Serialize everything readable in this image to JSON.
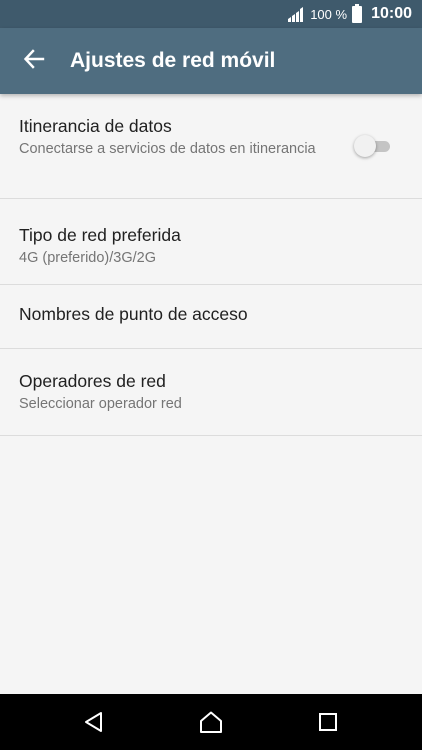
{
  "status_bar": {
    "battery_percent": "100 %",
    "time": "10:00",
    "icons": [
      "signal-icon",
      "battery-icon"
    ]
  },
  "app_bar": {
    "title": "Ajustes de red móvil",
    "back_icon": "arrow-left-icon"
  },
  "settings": {
    "items": [
      {
        "title": "Itinerancia de datos",
        "summary": "Conectarse a servicios de datos en itinerancia",
        "toggle": {
          "type": "switch",
          "on": false
        }
      },
      {
        "title": "Tipo de red preferida",
        "summary": "4G (preferido)/3G/2G"
      },
      {
        "title": "Nombres de punto de acceso"
      },
      {
        "title": "Operadores de red",
        "summary": "Seleccionar operador red"
      }
    ]
  },
  "nav_bar": {
    "icons": [
      "nav-back-icon",
      "nav-home-icon",
      "nav-recents-icon"
    ]
  },
  "colors": {
    "status_bar": "#3f5a6c",
    "app_bar": "#4f6d80",
    "background": "#f5f5f5",
    "divider": "#dcdcdc",
    "title_text": "#212121",
    "summary_text": "#757575",
    "nav_bar": "#000000"
  }
}
